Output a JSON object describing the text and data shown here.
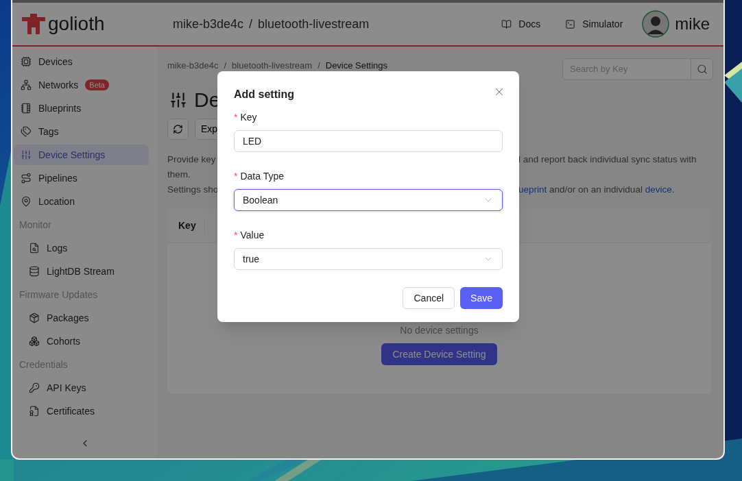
{
  "header": {
    "logo_text": "golioth",
    "project": [
      "mike-b3de4c",
      "/",
      "bluetooth-livestream"
    ],
    "links": [
      {
        "label": "Docs",
        "kind": "docs"
      },
      {
        "label": "Simulator",
        "kind": "terminal"
      }
    ],
    "user": {
      "name": "mike"
    }
  },
  "sidebar": {
    "groups": [
      {
        "items": [
          {
            "label": "Devices",
            "kind": "devices",
            "selected": false
          },
          {
            "label": "Networks",
            "kind": "networks",
            "selected": false,
            "badge": "Beta"
          },
          {
            "label": "Blueprints",
            "kind": "blueprints",
            "selected": false
          },
          {
            "label": "Tags",
            "kind": "tags",
            "selected": false
          },
          {
            "label": "Device Settings",
            "kind": "settings",
            "selected": true
          },
          {
            "label": "Pipelines",
            "kind": "pipelines",
            "selected": false
          },
          {
            "label": "Location",
            "kind": "location",
            "selected": false
          }
        ]
      },
      {
        "heading": "Monitor",
        "items": [
          {
            "label": "Logs",
            "kind": "logs",
            "selected": false
          },
          {
            "label": "LightDB Stream",
            "kind": "stream",
            "selected": false
          }
        ]
      },
      {
        "heading": "Firmware Updates",
        "items": [
          {
            "label": "Packages",
            "kind": "packages",
            "selected": false
          },
          {
            "label": "Cohorts",
            "kind": "cohorts",
            "selected": false
          }
        ]
      },
      {
        "heading": "Credentials",
        "items": [
          {
            "label": "API Keys",
            "kind": "keys",
            "selected": false
          },
          {
            "label": "Certificates",
            "kind": "certificates",
            "selected": false
          }
        ]
      }
    ]
  },
  "breadcrumb": [
    "mike-b3de4c",
    "/",
    "bluetooth-livestream",
    "/",
    "Device Settings"
  ],
  "search": {
    "placeholder": "Search by Key"
  },
  "page_title": "De",
  "toolbar": {
    "export_label": "Exp"
  },
  "description": [
    {
      "left": "Provide key",
      "right": [
        {
          "kind": "text",
          "text": "l and report back individual sync status with"
        }
      ]
    },
    {
      "left": "them."
    },
    {
      "left": "Settings sho",
      "right": [
        {
          "kind": "link",
          "text": "ueprint"
        },
        {
          "kind": "text",
          "text": " and/or on an individual "
        },
        {
          "kind": "link",
          "text": "device"
        },
        {
          "kind": "text",
          "text": "."
        }
      ]
    }
  ],
  "table": {
    "columns": [
      "Key"
    ],
    "empty_text": "No device settings",
    "create_button": "Create Device Setting"
  },
  "modal": {
    "title": "Add setting",
    "fields": [
      {
        "marker": "*",
        "label": "Key",
        "kind": "input",
        "value": "LED",
        "focused": false
      },
      {
        "marker": "*",
        "label": "Data Type",
        "kind": "select",
        "value": "Boolean",
        "focused": true
      },
      {
        "marker": "*",
        "label": "Value",
        "kind": "select",
        "value": "true",
        "focused": false
      }
    ],
    "buttons": [
      {
        "label": "Cancel",
        "kind": "secondary"
      },
      {
        "label": "Save",
        "kind": "primary"
      }
    ]
  }
}
